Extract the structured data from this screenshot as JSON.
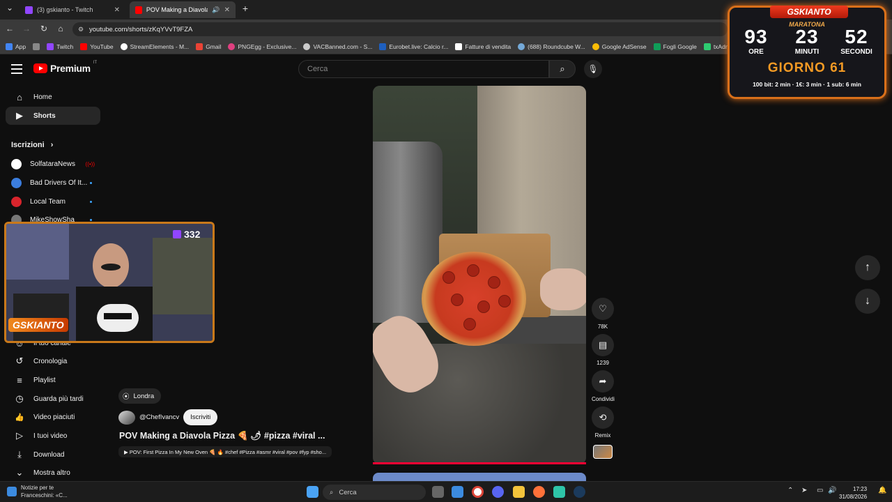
{
  "tabs": [
    {
      "label": "(3) gskianto - Twitch",
      "color": "#9146ff"
    },
    {
      "label": "POV Making a Diavola Pizza",
      "color": "#ff0000"
    }
  ],
  "window_controls": {
    "new_tab": "+",
    "minimize": "—",
    "maximize": "□",
    "close": "✕"
  },
  "address": {
    "url": "youtube.com/shorts/zKqYVvT9FZA"
  },
  "bookmarks": [
    {
      "label": "App",
      "color": "#4285f4"
    },
    {
      "label": "",
      "color": "#888888"
    },
    {
      "label": "Twitch",
      "color": "#9146ff"
    },
    {
      "label": "YouTube",
      "color": "#ff0000"
    },
    {
      "label": "StreamElements - M...",
      "color": "#ffffff"
    },
    {
      "label": "Gmail",
      "color": "#ea4335"
    },
    {
      "label": "PNGEgg - Exclusive...",
      "color": "#e04080"
    },
    {
      "label": "VACBanned.com - S...",
      "color": "#cccccc"
    },
    {
      "label": "Eurobet.live: Calcio r...",
      "color": "#1e5fbf"
    },
    {
      "label": "Fatture di vendita",
      "color": "#ffffff"
    },
    {
      "label": "(688) Roundcube W...",
      "color": "#74a9d8"
    },
    {
      "label": "Google AdSense",
      "color": "#fbbc05"
    },
    {
      "label": "Fogli Google",
      "color": "#0f9d58"
    },
    {
      "label": "txAdmin",
      "color": "#2ecc71"
    }
  ],
  "youtube": {
    "logo": "Premium",
    "country": "IT",
    "search_placeholder": "Cerca"
  },
  "sidebar": {
    "top": [
      {
        "label": "Home",
        "icon": "home-icon",
        "glyph": "⌂"
      },
      {
        "label": "Shorts",
        "icon": "shorts-icon",
        "glyph": "▶"
      }
    ],
    "subs_header": "Iscrizioni",
    "subs": [
      {
        "label": "SolfataraNews",
        "color": "#ffffff",
        "status": "live"
      },
      {
        "label": "Bad Drivers Of It...",
        "color": "#3b7ddd",
        "status": "new"
      },
      {
        "label": "Local Team",
        "color": "#d8242c",
        "status": "new"
      },
      {
        "label": "MikeShowSha",
        "color": "#777777",
        "status": "new"
      }
    ],
    "you": [
      {
        "label": "Il tuo canale",
        "icon": "channel-icon",
        "glyph": "☺"
      },
      {
        "label": "Cronologia",
        "icon": "history-icon",
        "glyph": "↺"
      },
      {
        "label": "Playlist",
        "icon": "playlist-icon",
        "glyph": "≡"
      },
      {
        "label": "Guarda più tardi",
        "icon": "watch-later-icon",
        "glyph": "◷"
      },
      {
        "label": "Video piaciuti",
        "icon": "like-icon",
        "glyph": "👍"
      },
      {
        "label": "I tuoi video",
        "icon": "your-videos-icon",
        "glyph": "▷"
      },
      {
        "label": "Download",
        "icon": "download-icon",
        "glyph": "⤓"
      },
      {
        "label": "Mostra altro",
        "icon": "chevron-down-icon",
        "glyph": "⌄"
      }
    ]
  },
  "webcam": {
    "viewers": "332",
    "brand": "GSKIANTO"
  },
  "short": {
    "location": "Londra",
    "channel": "@ChefIvancv",
    "subscribe": "Iscriviti",
    "title": "POV Making a Diavola Pizza 🍕 🌶 #pizza #viral ...",
    "linked": "▶ POV: First Pizza In My New Oven 🍕 🔥 #chef #Pizza #asmr #viral #pov #fyp #sho..."
  },
  "actions": [
    {
      "label": "78K",
      "icon": "heart-icon",
      "glyph": "♡"
    },
    {
      "label": "1239",
      "icon": "comment-icon",
      "glyph": "▤"
    },
    {
      "label": "Condividi",
      "icon": "share-icon",
      "glyph": "➦"
    },
    {
      "label": "Remix",
      "icon": "remix-icon",
      "glyph": "⟲"
    }
  ],
  "nav_arrows": {
    "up": "↑",
    "down": "↓"
  },
  "timer": {
    "title": "GSKIANTO",
    "subtitle": "MARATONA",
    "hours": "93",
    "minutes": "23",
    "seconds": "52",
    "hours_label": "ORE",
    "minutes_label": "MINUTI",
    "seconds_label": "SECONDI",
    "day": "GIORNO 61",
    "rules": "100 bit: 2 min · 1€: 3 min · 1 sub: 6 min"
  },
  "taskbar": {
    "news_title": "Notizie per te",
    "news_sub": "Franceschini: «C...",
    "search": "Cerca",
    "time": "17:23",
    "date": "31/08/2026",
    "apps": [
      "#4aa3f5",
      "#666666",
      "#3c8be0",
      "#ffffff",
      "#5865f2",
      "#f3c33b",
      "#ff7139",
      "#2ec4a8",
      "#1b3a5c"
    ]
  }
}
